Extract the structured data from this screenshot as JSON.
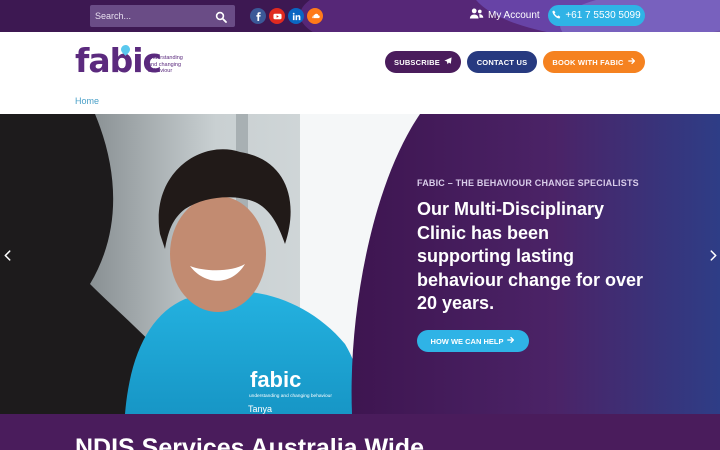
{
  "topbar": {
    "search": {
      "placeholder": "Search...",
      "icon": "search-icon"
    },
    "social": [
      {
        "name": "facebook",
        "icon": "facebook-icon",
        "color": "#3b5998"
      },
      {
        "name": "youtube",
        "icon": "youtube-icon",
        "color": "#e02a20"
      },
      {
        "name": "linkedin",
        "icon": "linkedin-icon",
        "color": "#0a66c2"
      },
      {
        "name": "soundcloud",
        "icon": "soundcloud-icon",
        "color": "#ff7a1a"
      }
    ],
    "account_label": "My Account",
    "phone_label": "+61 7 5530 5099"
  },
  "header": {
    "logo_word": "fabic",
    "logo_tagline": "understanding and changing behaviour",
    "buttons": {
      "subscribe": "SUBSCRIBE",
      "contact": "CONTACT US",
      "book": "BOOK WITH FABIC"
    },
    "breadcrumb": "Home"
  },
  "hero": {
    "kicker": "FABIC – THE BEHAVIOUR CHANGE SPECIALISTS",
    "title": "Our Multi-Disciplinary Clinic has been supporting lasting behaviour change for over 20 years.",
    "cta": "HOW WE CAN HELP",
    "jacket_logo": "fabic",
    "jacket_tagline": "understanding and changing behaviour",
    "name_tag": "Tanya"
  },
  "section": {
    "heading": "NDIS Services Australia Wide"
  },
  "colors": {
    "brand_purple": "#4a1c5c",
    "navy": "#273a80",
    "orange": "#f58220",
    "cyan": "#2fb3e6"
  }
}
